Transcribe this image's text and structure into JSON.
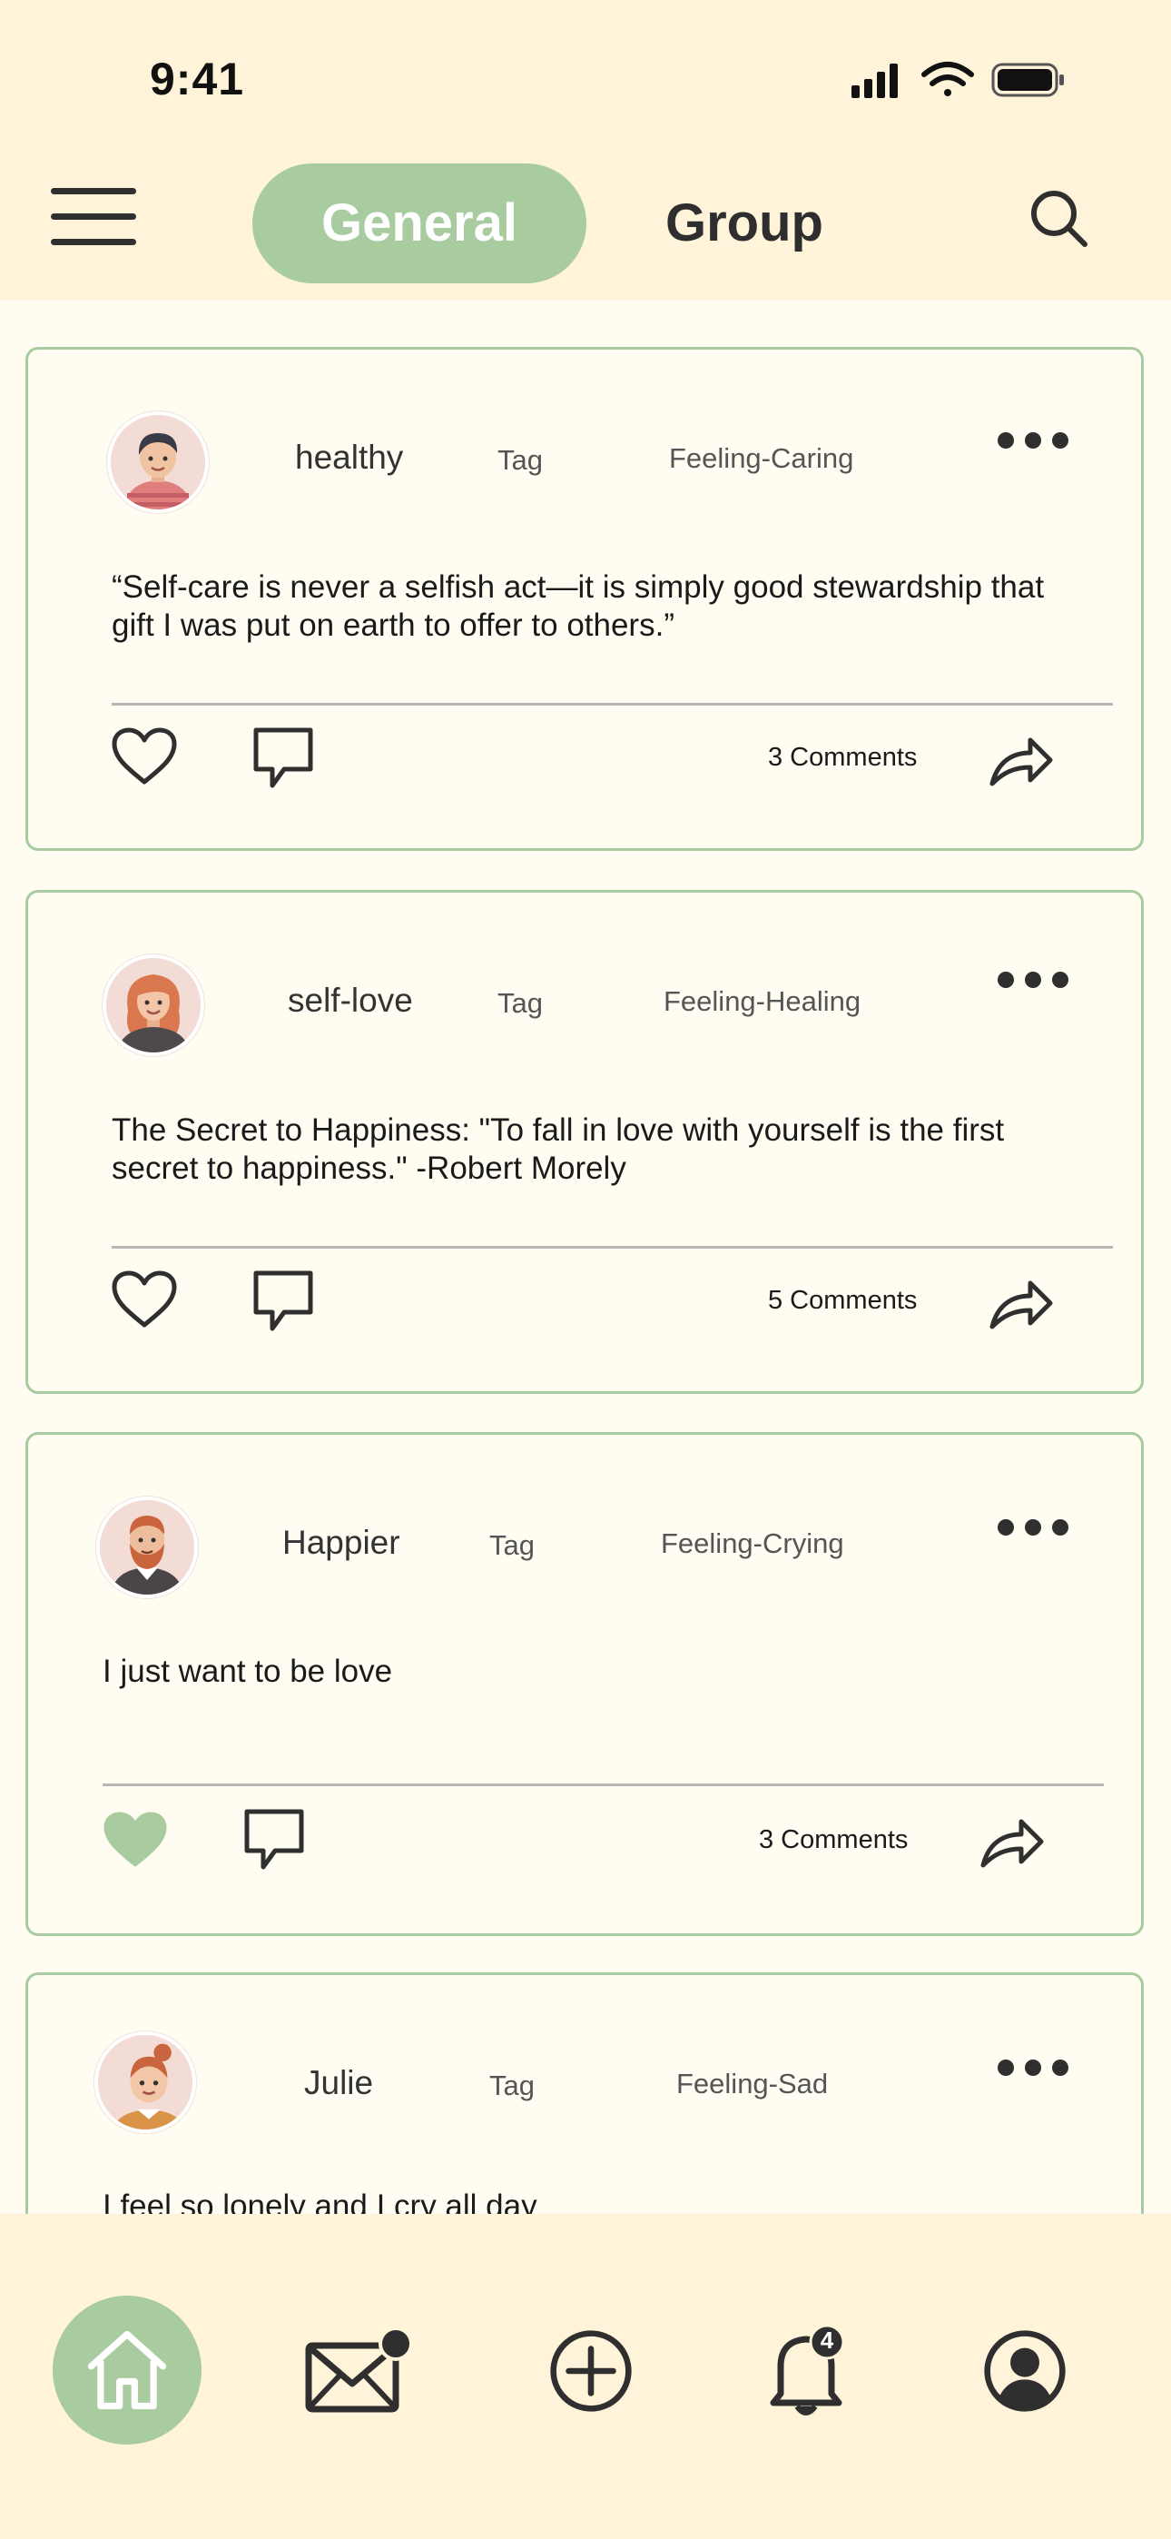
{
  "status": {
    "time": "9:41"
  },
  "header": {
    "tabs": [
      {
        "label": "General",
        "active": true
      },
      {
        "label": "Group",
        "active": false
      }
    ],
    "accent_color": "#a8cba0"
  },
  "posts": [
    {
      "username": "healthy",
      "tag": "Tag",
      "feeling": "Feeling-Caring",
      "text": "“Self-care is never a selfish act—it is simply good stewardship that gift I was put on earth to offer to others.”",
      "comments": "3 Comments",
      "liked": false
    },
    {
      "username": "self-love",
      "tag": "Tag",
      "feeling": "Feeling-Healing",
      "text": "The Secret to Happiness: \"To fall in love with yourself is the first secret to happiness.\" -Robert Morely",
      "comments": "5 Comments",
      "liked": false
    },
    {
      "username": "Happier",
      "tag": "Tag",
      "feeling": "Feeling-Crying",
      "text": "I just want to be love",
      "comments": "3 Comments",
      "liked": true
    },
    {
      "username": "Julie",
      "tag": "Tag",
      "feeling": "Feeling-Sad",
      "text": "I feel so lonely and I cry all day"
    }
  ],
  "bottom_nav": {
    "items": [
      "home-icon",
      "mail-icon",
      "add-icon",
      "bell-icon",
      "profile-icon"
    ],
    "notification_count": "4"
  }
}
